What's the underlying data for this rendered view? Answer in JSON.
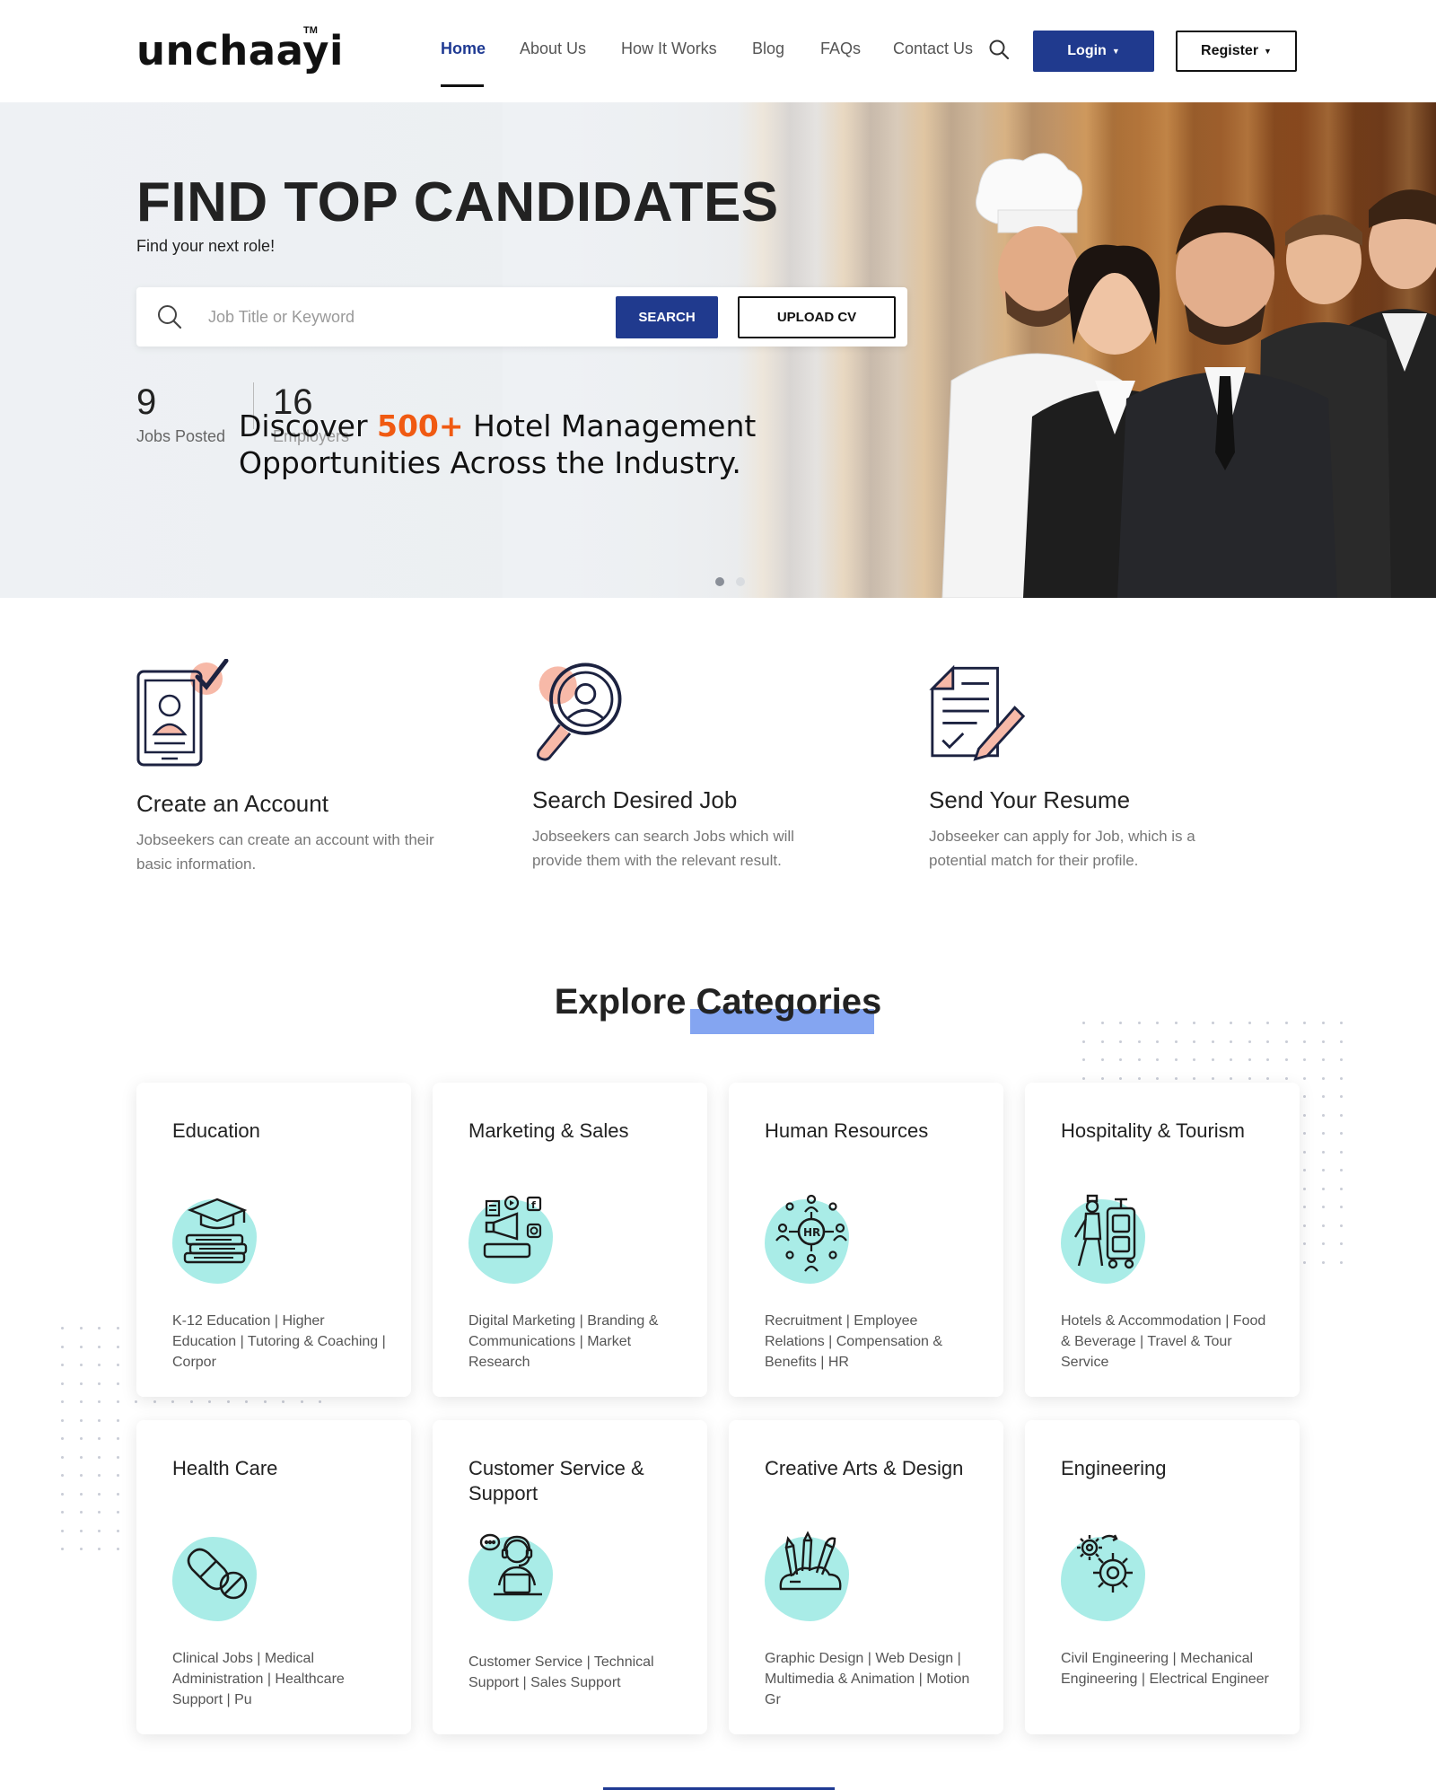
{
  "header": {
    "logo": "unchaayi",
    "logo_tm": "TM",
    "nav": [
      "Home",
      "About Us",
      "How It Works",
      "Blog",
      "FAQs",
      "Contact Us"
    ],
    "active_nav": "Home",
    "login_label": "Login",
    "register_label": "Register"
  },
  "hero": {
    "title": "FIND TOP CANDIDATES",
    "subtitle": "Find your next role!",
    "search_placeholder": "Job Title or Keyword",
    "search_button": "SEARCH",
    "upload_button": "UPLOAD CV",
    "stats": [
      {
        "value": "9",
        "label": "Jobs Posted"
      },
      {
        "value": "16",
        "label": "Employers"
      }
    ],
    "tagline_pre": "Discover ",
    "tagline_accent": "500+",
    "tagline_post": " Hotel Management",
    "tagline_line2": "Opportunities Across the Industry.",
    "carousel_active": 1,
    "carousel_count": 2
  },
  "steps": [
    {
      "title": "Create an Account",
      "desc": "Jobseekers can create an account with their basic information.",
      "icon": "account-phone-check-icon"
    },
    {
      "title": "Search Desired Job",
      "desc": "Jobseekers can search Jobs which will provide them with the relevant result.",
      "icon": "magnifier-person-icon"
    },
    {
      "title": "Send Your Resume",
      "desc": "Jobseeker can apply for Job, which is a potential match for their profile.",
      "icon": "resume-pen-icon"
    }
  ],
  "categories": {
    "heading_part1": "Explore",
    "heading_part2": "Categories",
    "items": [
      {
        "title": "Education",
        "desc": "K-12 Education | Higher Education | Tutoring & Coaching | Corpor",
        "icon": "education-books-icon"
      },
      {
        "title": "Marketing & Sales",
        "desc": "Digital Marketing | Branding & Communications | Market Research",
        "icon": "megaphone-social-icon"
      },
      {
        "title": "Human Resources",
        "desc": "Recruitment | Employee Relations | Compensation & Benefits | HR",
        "icon": "hr-network-icon"
      },
      {
        "title": "Hospitality & Tourism",
        "desc": "Hotels & Accommodation | Food & Beverage | Travel & Tour Service",
        "icon": "bellhop-luggage-icon"
      },
      {
        "title": "Health Care",
        "desc": "Clinical Jobs | Medical Administration | Healthcare Support | Pu",
        "icon": "pill-capsule-icon"
      },
      {
        "title": "Customer Service & Support",
        "desc": "Customer Service | Technical Support | Sales Support",
        "icon": "support-agent-icon"
      },
      {
        "title": "Creative Arts & Design",
        "desc": "Graphic Design | Web Design | Multimedia & Animation | Motion Gr",
        "icon": "art-supplies-icon"
      },
      {
        "title": "Engineering",
        "desc": "Civil Engineering | Mechanical Engineering | Electrical Engineer",
        "icon": "gears-icon"
      }
    ]
  },
  "colors": {
    "brand_blue": "#203a8e",
    "accent_orange": "#f05a12",
    "icon_blob": "#a9ece7",
    "heading_highlight": "#6f95ee"
  }
}
